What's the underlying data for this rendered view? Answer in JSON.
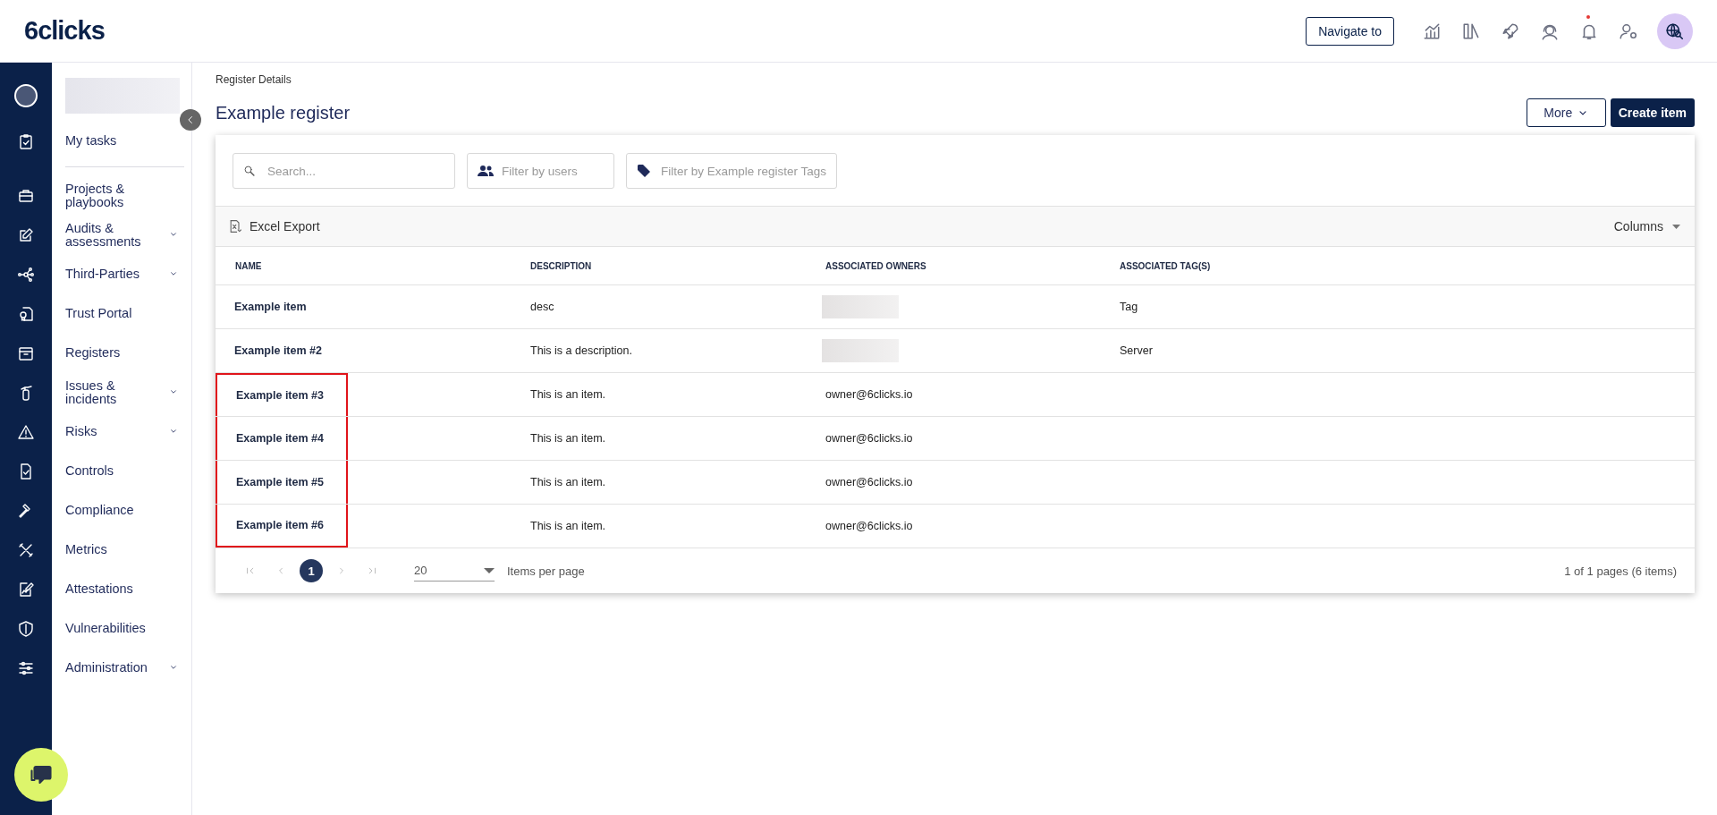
{
  "top_bar": {
    "logo": "6clicks",
    "navigate_button": "Navigate to",
    "notifications_unread": true
  },
  "sidebar": {
    "my_tasks": "My tasks",
    "items": [
      {
        "label": "Projects & playbooks",
        "expandable": false
      },
      {
        "label": "Audits & assessments",
        "expandable": true
      },
      {
        "label": "Third-Parties",
        "expandable": true
      },
      {
        "label": "Trust Portal",
        "expandable": false
      },
      {
        "label": "Registers",
        "expandable": false
      },
      {
        "label": "Issues & incidents",
        "expandable": true
      },
      {
        "label": "Risks",
        "expandable": true
      },
      {
        "label": "Controls",
        "expandable": false
      },
      {
        "label": "Compliance",
        "expandable": false
      },
      {
        "label": "Metrics",
        "expandable": false
      },
      {
        "label": "Attestations",
        "expandable": false
      },
      {
        "label": "Vulnerabilities",
        "expandable": false
      },
      {
        "label": "Administration",
        "expandable": true
      }
    ]
  },
  "breadcrumb": "Register Details",
  "page_title": "Example register",
  "actions": {
    "more": "More",
    "create": "Create item"
  },
  "filters": {
    "search_placeholder": "Search...",
    "users_placeholder": "Filter by users",
    "tags_placeholder": "Filter by Example register Tags"
  },
  "toolbar": {
    "export": "Excel Export",
    "columns": "Columns"
  },
  "table": {
    "columns": [
      "NAME",
      "DESCRIPTION",
      "ASSOCIATED OWNERS",
      "ASSOCIATED TAG(S)"
    ],
    "rows": [
      {
        "name": "Example item",
        "description": "desc",
        "owner_redacted": true,
        "tag": "Tag",
        "highlighted": false
      },
      {
        "name": "Example item #2",
        "description": "This is a description.",
        "owner_redacted": true,
        "tag": "Server",
        "highlighted": false
      },
      {
        "name": "Example item #3",
        "description": "This is an item.",
        "owner": "owner@6clicks.io",
        "highlighted": true
      },
      {
        "name": "Example item #4",
        "description": "This is an item.",
        "owner": "owner@6clicks.io",
        "highlighted": true
      },
      {
        "name": "Example item #5",
        "description": "This is an item.",
        "owner": "owner@6clicks.io",
        "highlighted": true
      },
      {
        "name": "Example item #6",
        "description": "This is an item.",
        "owner": "owner@6clicks.io",
        "highlighted": true
      }
    ]
  },
  "pagination": {
    "pages": [
      {
        "label": "1",
        "selected": true
      }
    ],
    "per_page": "20",
    "per_page_label": "Items per page",
    "summary": "1 of 1 pages (6 items)"
  }
}
